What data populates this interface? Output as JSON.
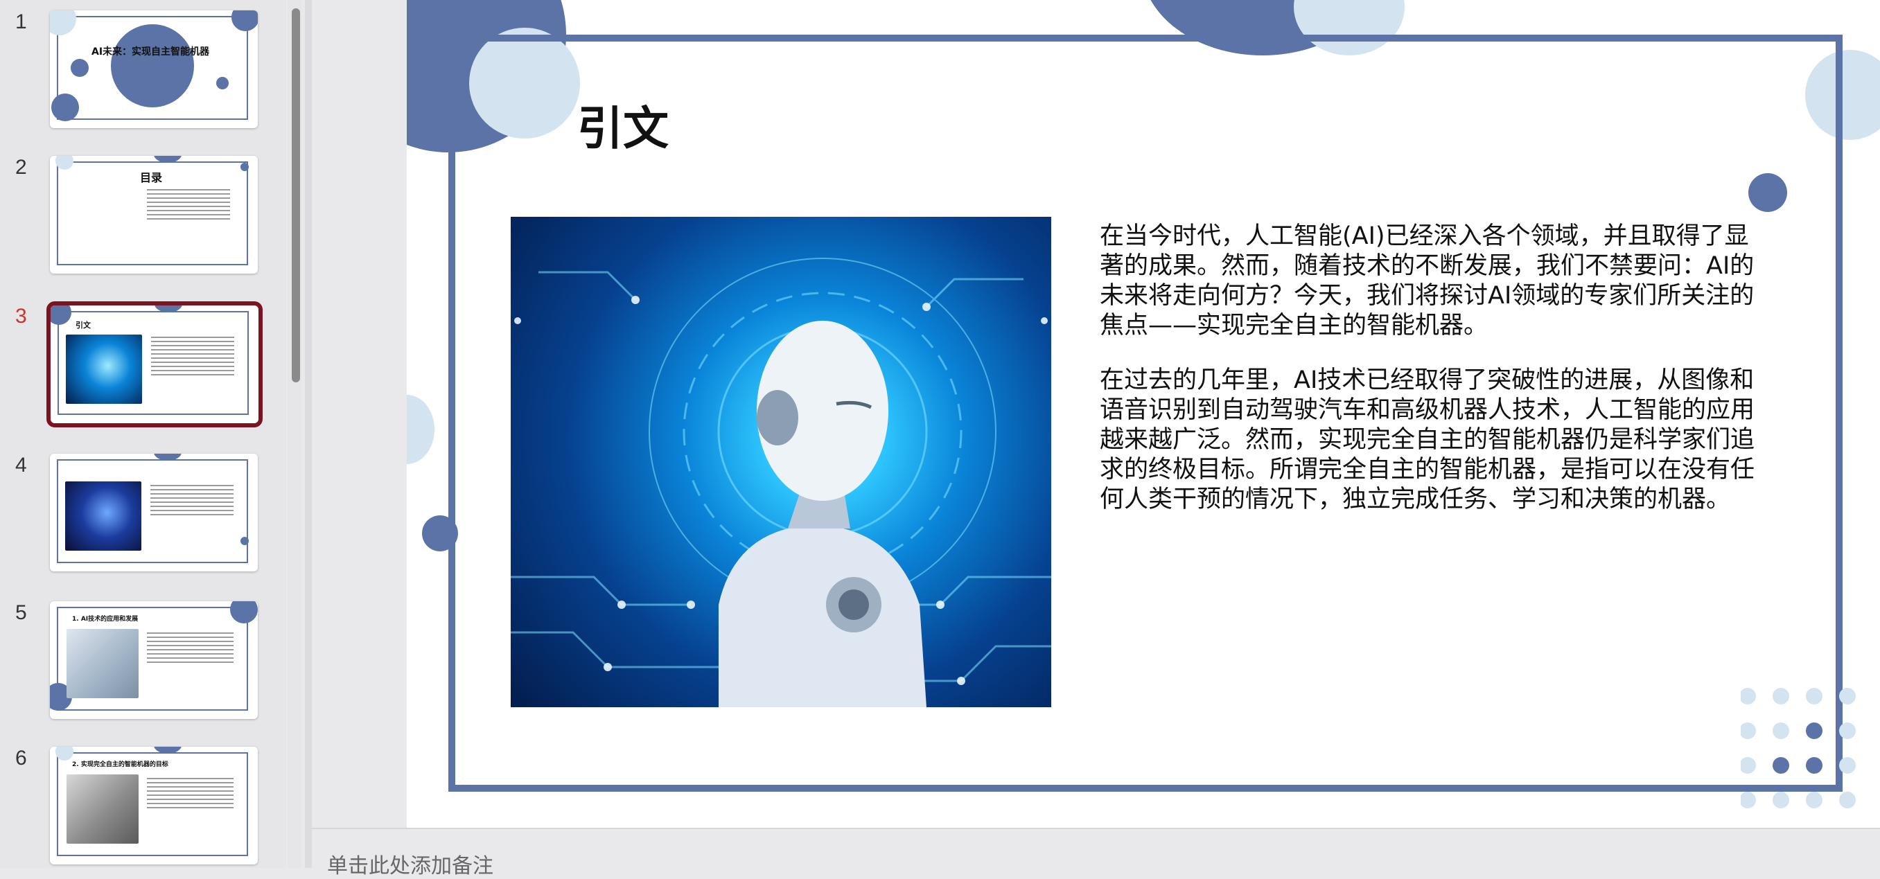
{
  "thumbnails": [
    {
      "num": "1",
      "title": "AI未来：实现自主智能机器"
    },
    {
      "num": "2",
      "title": "目录"
    },
    {
      "num": "3",
      "title": "引文"
    },
    {
      "num": "4",
      "title": ""
    },
    {
      "num": "5",
      "title": "1. AI技术的应用和发展"
    },
    {
      "num": "6",
      "title": "2. 实现完全自主的智能机器的目标"
    }
  ],
  "active_slide": "3",
  "slide": {
    "title": "引文",
    "paragraphs": [
      "在当今时代，人工智能(AI)已经深入各个领域，并且取得了显著的成果。然而，随着技术的不断发展，我们不禁要问：AI的未来将走向何方？今天，我们将探讨AI领域的专家们所关注的焦点——实现完全自主的智能机器。",
      "在过去的几年里，AI技术已经取得了突破性的进展，从图像和语音识别到自动驾驶汽车和高级机器人技术，人工智能的应用越来越广泛。然而，实现完全自主的智能机器仍是科学家们追求的终极目标。所谓完全自主的智能机器，是指可以在没有任何人类干预的情况下，独立完成任务、学习和决策的机器。"
    ]
  },
  "notes": {
    "placeholder": "单击此处添加备注"
  },
  "colors": {
    "accent": "#5b73a6",
    "light_accent": "#d3e3f0",
    "active_border": "#7a1420",
    "active_num": "#c0392b"
  }
}
